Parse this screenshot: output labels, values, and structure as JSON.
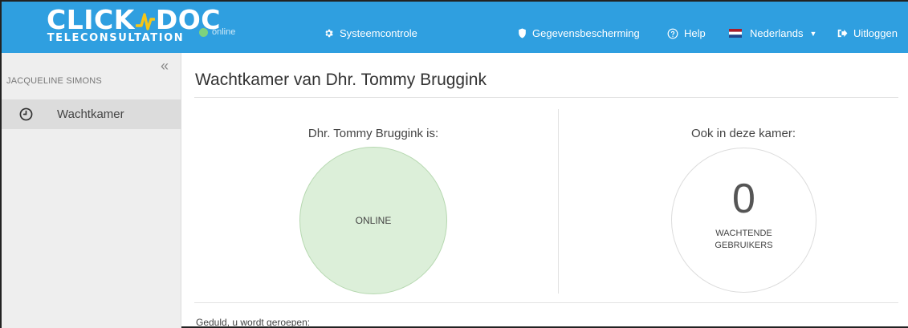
{
  "brand": {
    "name_part1": "CLICK",
    "name_part2": "DOC",
    "subtitle": "TELECONSULTATION",
    "accent": "#f5c518"
  },
  "header": {
    "status": "online",
    "nav": [
      {
        "label": "Systeemcontrole",
        "icon": "gear-icon"
      },
      {
        "label": "Gegevensbescherming",
        "icon": "shield-icon"
      },
      {
        "label": "Help",
        "icon": "question-circle-icon"
      },
      {
        "label": "Nederlands",
        "icon": "dutch-flag-icon"
      },
      {
        "label": "Uitloggen",
        "icon": "logout-icon"
      }
    ],
    "bg_color": "#2f9fe0"
  },
  "sidebar": {
    "user": "JACQUELINE SIMONS",
    "items": [
      {
        "label": "Wachtkamer",
        "icon": "clock-icon"
      }
    ]
  },
  "main": {
    "title": "Wachtkamer van Dhr. Tommy Bruggink",
    "left": {
      "heading": "Dhr. Tommy Bruggink is:",
      "status": "ONLINE"
    },
    "right": {
      "heading": "Ook in deze kamer:",
      "count": "0",
      "label_line1": "WACHTENDE",
      "label_line2": "GEBRUIKERS"
    },
    "footer": "Geduld, u wordt geroepen:"
  }
}
